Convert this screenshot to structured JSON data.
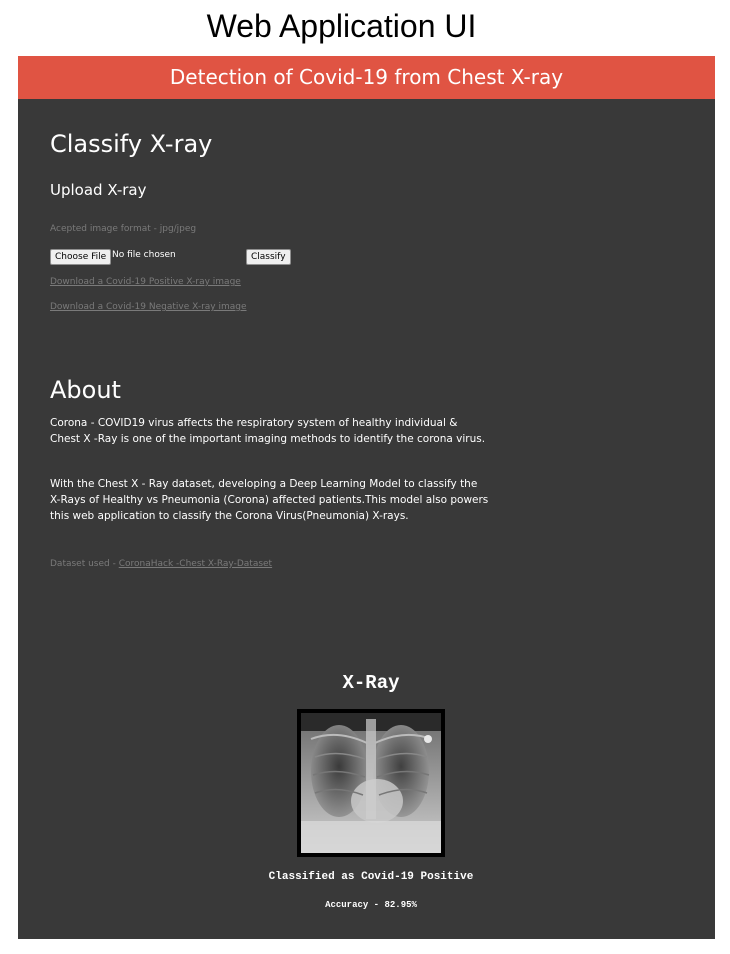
{
  "caption": "Web Application UI",
  "navbar": {
    "title": "Detection of Covid-19 from Chest X-ray"
  },
  "classify": {
    "heading": "Classify X-ray",
    "subheading": "Upload X-ray",
    "format_hint": "Acepted image format - jpg/jpeg",
    "choose_file_label": "Choose File",
    "no_file_text": "No file chosen",
    "classify_label": "Classify",
    "download_positive": "Download a Covid-19 Positive X-ray image",
    "download_negative": "Download a Covid-19 Negative X-ray image"
  },
  "about": {
    "heading": "About",
    "paragraph1": "Corona - COVID19 virus affects the respiratory system of healthy individual & Chest X -Ray is one of the important imaging methods to identify the corona virus.",
    "paragraph2": "With the Chest X - Ray dataset, developing a Deep Learning Model to classify the X-Rays of Healthy vs Pneumonia (Corona) affected patients.This model also powers this web application to classify the Corona Virus(Pneumonia) X-rays.",
    "dataset_prefix": "Dataset used - ",
    "dataset_link": "CoronaHack -Chest X-Ray-Dataset"
  },
  "result": {
    "title": "X-Ray",
    "classification": "Classified as Covid-19 Positive",
    "accuracy": "Accuracy - 82.95%"
  },
  "colors": {
    "navbar": "#e05443",
    "background": "#393939",
    "muted_text": "#7a7a7a"
  }
}
